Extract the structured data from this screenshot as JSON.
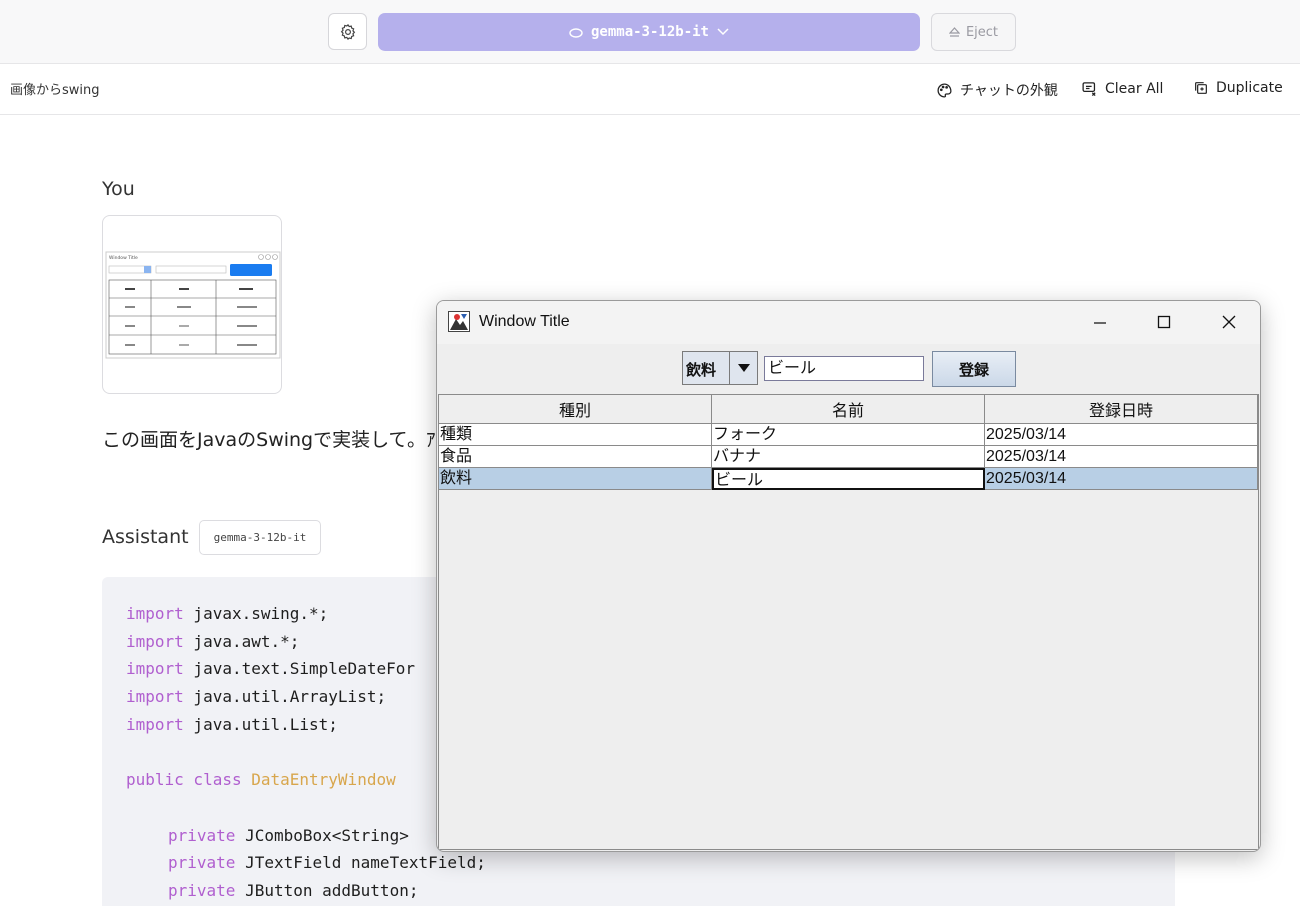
{
  "topbar": {
    "model_name": "gemma-3-12b-it",
    "eject_label": "Eject"
  },
  "chat_header": {
    "title": "画像からswing",
    "appearance_label": "チャットの外観",
    "clear_label": "Clear All",
    "duplicate_label": "Duplicate"
  },
  "user": {
    "label": "You",
    "message": "この画面をJavaのSwingで実装して。ｱ"
  },
  "assistant": {
    "label": "Assistant",
    "model_chip": "gemma-3-12b-it",
    "code": {
      "l1_kw": "import",
      "l1_rest": " javax.swing.*;",
      "l2_kw": "import",
      "l2_rest": " java.awt.*;",
      "l3_kw": "import",
      "l3_rest": " java.text.SimpleDateFor",
      "l4_kw": "import",
      "l4_rest": " java.util.ArrayList;",
      "l5_kw": "import",
      "l5_rest": " java.util.List;",
      "l6_kw": "public class",
      "l6_cls": " DataEntryWindow",
      "l7_kw": "private",
      "l7_rest": " JComboBox<String>",
      "l8_kw": "private",
      "l8_rest": " JTextField nameTextField;",
      "l9_kw": "private",
      "l9_rest": " JButton addButton;"
    }
  },
  "thumbnail": {
    "title": "Window Title"
  },
  "swing_window": {
    "title": "Window Title",
    "combo_value": "飲料",
    "text_value": "ビール",
    "button_label": "登録",
    "columns": [
      "種別",
      "名前",
      "登録日時"
    ],
    "rows": [
      [
        "種類",
        "フォーク",
        "2025/03/14"
      ],
      [
        "食品",
        "バナナ",
        "2025/03/14"
      ],
      [
        "飲料",
        "ビール",
        "2025/03/14"
      ]
    ],
    "selected_row": 2
  }
}
